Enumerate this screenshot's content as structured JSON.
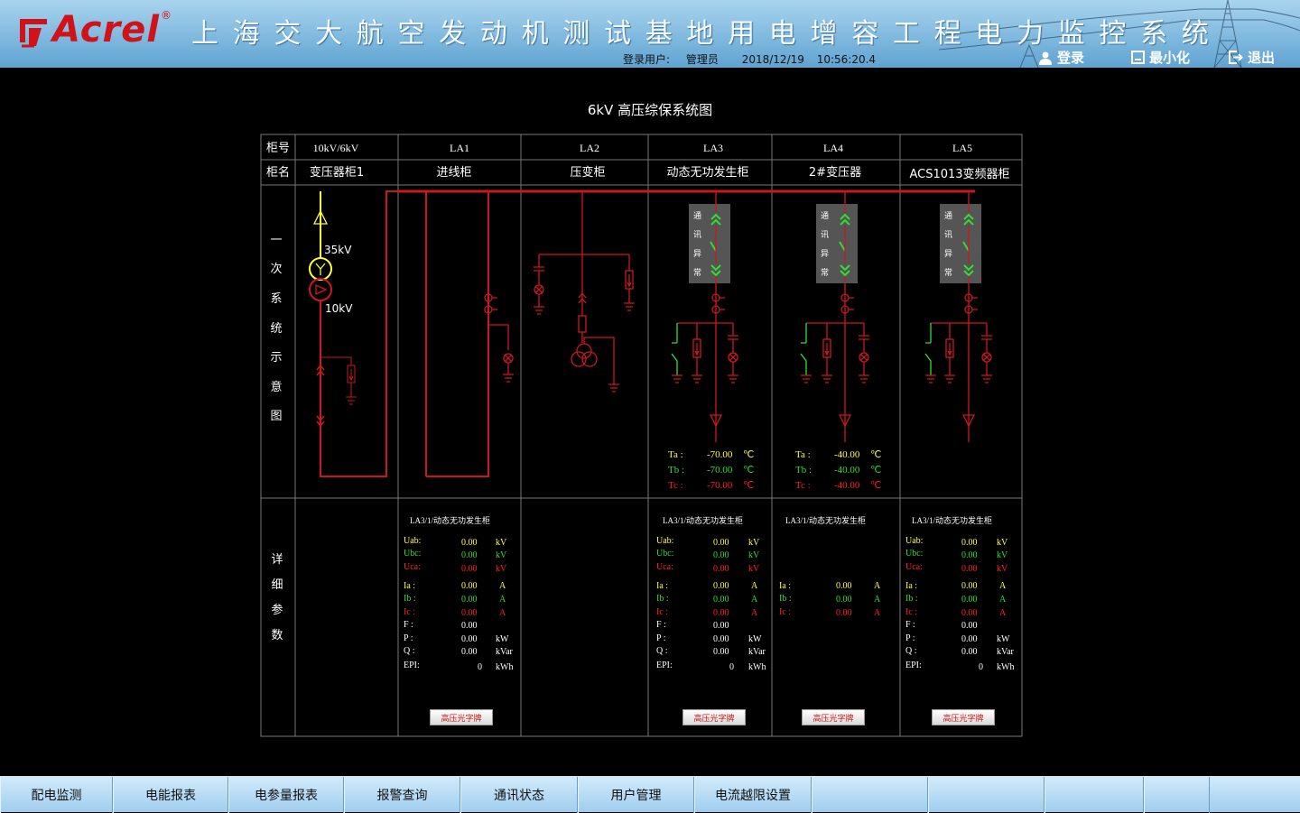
{
  "header": {
    "logo_text": "Acrel",
    "logo_reg": "®",
    "title": "上海交大航空发动机测试基地用电增容工程电力监控系统",
    "user_label": "登录用户:",
    "user_name": "管理员",
    "date": "2018/12/19",
    "time": "10:56:20.4",
    "login_label": "登录",
    "minimize_label": "最小化",
    "exit_label": "退出"
  },
  "diagram": {
    "title": "6kV 高压综保系统图",
    "row_cabinet_no": "柜号",
    "row_cabinet_name": "柜名",
    "row_primary": [
      "一",
      "次",
      "系",
      "统",
      "示",
      "意",
      "图"
    ],
    "row_detail": [
      "详",
      "细",
      "参",
      "数"
    ],
    "columns": [
      {
        "no": "10kV/6kV",
        "name": "变压器柜1"
      },
      {
        "no": "LA1",
        "name": "进线柜"
      },
      {
        "no": "LA2",
        "name": "压变柜"
      },
      {
        "no": "LA3",
        "name": "动态无功发生柜"
      },
      {
        "no": "LA4",
        "name": "2#变压器"
      },
      {
        "no": "LA5",
        "name": "ACS1013变频器柜"
      }
    ],
    "transformer_hv": "35kV",
    "transformer_lv": "10kV",
    "comm_status_chars": [
      "通",
      "讯",
      "异",
      "常"
    ]
  },
  "temps": {
    "la3": {
      "ta": "-70.00",
      "tb": "-70.00",
      "tc": "-70.00"
    },
    "la4": {
      "ta": "-40.00",
      "tb": "-40.00",
      "tc": "-40.00"
    },
    "labels": {
      "ta": "Ta :",
      "tb": "Tb :",
      "tc": "Tc :"
    },
    "unit": "℃"
  },
  "panels": {
    "la1": {
      "title": "LA3/1/动态无功发生柜",
      "uab": "0.00",
      "ubc": "0.00",
      "uca": "0.00",
      "ia": "0.00",
      "ib": "0.00",
      "ic": "0.00",
      "f": "0.00",
      "p": "0.00",
      "q": "0.00",
      "epi": "0"
    },
    "la3": {
      "title": "LA3/1/动态无功发生柜",
      "uab": "0.00",
      "ubc": "0.00",
      "uca": "0.00",
      "ia": "0.00",
      "ib": "0.00",
      "ic": "0.00",
      "f": "0.00",
      "p": "0.00",
      "q": "0.00",
      "epi": "0"
    },
    "la4": {
      "title": "LA3/1/动态无功发生柜",
      "ia": "0.00",
      "ib": "0.00",
      "ic": "0.00"
    },
    "la5": {
      "title": "LA3/1/动态无功发生柜",
      "uab": "0.00",
      "ubc": "0.00",
      "uca": "0.00",
      "ia": "0.00",
      "ib": "0.00",
      "ic": "0.00",
      "f": "0.00",
      "p": "0.00",
      "q": "0.00",
      "epi": "0"
    },
    "labels": {
      "uab": "Uab:",
      "ubc": "Ubc:",
      "uca": "Uca:",
      "ia": "Ia :",
      "ib": "Ib :",
      "ic": "Ic :",
      "f": "F :",
      "p": "P :",
      "q": "Q :",
      "epi": "EPI:"
    },
    "units": {
      "kv": "kV",
      "a": "A",
      "kw": "kW",
      "kvar": "kVar",
      "kwh": "kWh"
    },
    "button_label": "高压光字牌"
  },
  "footer": {
    "items": [
      "配电监测",
      "电能报表",
      "电参量报表",
      "报警查询",
      "通讯状态",
      "用户管理",
      "电流越限设置",
      "",
      "",
      "",
      ""
    ]
  },
  "colors": {
    "red": "#c8191e",
    "yellow": "#ffff33",
    "green": "#33dd33",
    "bright_red": "#ff2020",
    "grid": "#777777"
  }
}
